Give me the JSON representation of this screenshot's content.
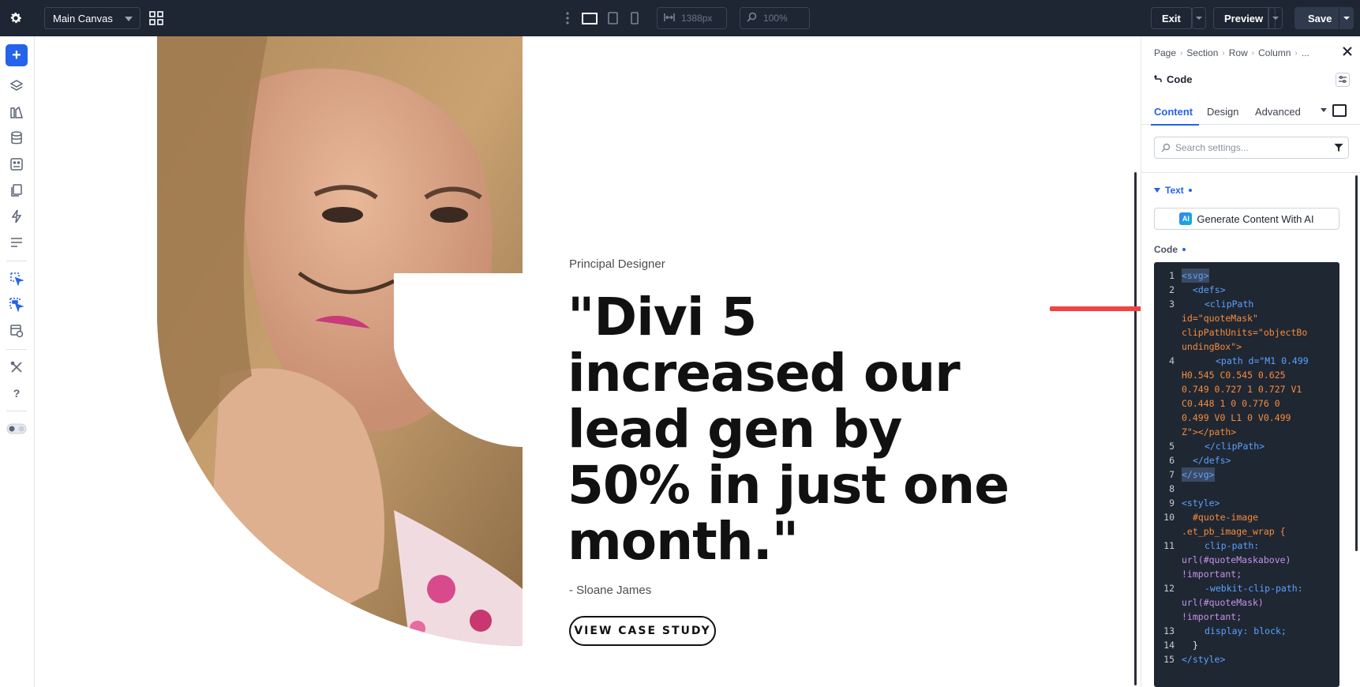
{
  "topbar": {
    "canvas_name": "Main Canvas",
    "width_value": "1388px",
    "zoom_value": "100%",
    "exit_label": "Exit",
    "preview_label": "Preview",
    "save_label": "Save"
  },
  "canvas": {
    "eyebrow": "Principal Designer",
    "quote": "\"Divi 5 increased our lead gen by 50% in just one month.\"",
    "author": "- Sloane James",
    "cta_label": "VIEW CASE STUDY"
  },
  "panel": {
    "breadcrumbs": [
      "Page",
      "Section",
      "Row",
      "Column",
      "..."
    ],
    "module_title": "Code",
    "tabs": [
      "Content",
      "Design",
      "Advanced"
    ],
    "search_placeholder": "Search settings...",
    "section_title": "Text",
    "ai_badge": "AI",
    "ai_button_label": "Generate Content With AI",
    "code_label": "Code",
    "code_line_numbers": [
      "1",
      "2",
      "3",
      "4",
      "5",
      "6",
      "7",
      "8",
      "9",
      "10",
      "11",
      "12",
      "13",
      "14",
      "15"
    ],
    "code_segments": [
      "<svg>",
      "<defs>",
      "<clipPath",
      "id=\"quoteMask\"",
      "clipPathUnits=\"objectBo",
      "undingBox\">",
      "<path d=\"M1 0.499",
      "H0.545 C0.545 0.625",
      "0.749 0.727 1 0.727 V1",
      "C0.448 1 0 0.776 0",
      "0.499 V0 L1 0 V0.499",
      "Z\"></path>",
      "</clipPath>",
      "</defs>",
      "</svg>",
      "<style>",
      "#quote-image",
      ".et_pb_image_wrap {",
      "clip-path:",
      "url(#quoteMaskabove)",
      "!important;",
      "-webkit-clip-path:",
      "url(#quoteMask)",
      "!important;",
      "display: block;",
      "}",
      "</style>"
    ]
  },
  "colors": {
    "topbar_bg": "#1e2533",
    "accent": "#2563eb",
    "editor_bg": "#1f2733",
    "annotation_arrow": "#ef4444"
  },
  "icons": [
    "gear-icon",
    "grid-icon",
    "kebab-icon",
    "desktop-icon",
    "tablet-icon",
    "phone-icon",
    "width-icon",
    "zoom-icon",
    "plus-icon",
    "layers-icon",
    "library-icon",
    "database-icon",
    "template-icon",
    "pages-icon",
    "bolt-icon",
    "list-icon",
    "select-icon",
    "multi-select-icon",
    "theme-builder-icon",
    "tools-icon",
    "help-icon",
    "toggle-icon",
    "close-icon",
    "undo-icon",
    "adjust-icon",
    "search-icon",
    "filter-icon"
  ]
}
